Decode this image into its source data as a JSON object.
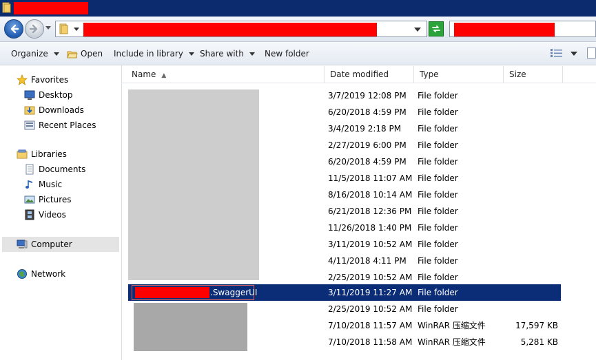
{
  "toolbar": {
    "organize": "Organize",
    "open": "Open",
    "include_in_library": "Include in library",
    "share_with": "Share with",
    "new_folder": "New folder"
  },
  "nav": {
    "favorites": "Favorites",
    "desktop": "Desktop",
    "downloads": "Downloads",
    "recent_places": "Recent Places",
    "libraries": "Libraries",
    "documents": "Documents",
    "music": "Music",
    "pictures": "Pictures",
    "videos": "Videos",
    "computer": "Computer",
    "network": "Network"
  },
  "columns": {
    "name": "Name",
    "date_modified": "Date modified",
    "type": "Type",
    "size": "Size"
  },
  "files": [
    {
      "name": "",
      "date": "3/7/2019 12:08 PM",
      "type": "File folder",
      "size": ""
    },
    {
      "name": "",
      "date": "6/20/2018 4:59 PM",
      "type": "File folder",
      "size": ""
    },
    {
      "name": "",
      "date": "3/4/2019 2:18 PM",
      "type": "File folder",
      "size": ""
    },
    {
      "name": "",
      "date": "2/27/2019 6:00 PM",
      "type": "File folder",
      "size": ""
    },
    {
      "name": "",
      "date": "6/20/2018 4:59 PM",
      "type": "File folder",
      "size": ""
    },
    {
      "name": "",
      "date": "11/5/2018 11:07 AM",
      "type": "File folder",
      "size": ""
    },
    {
      "name": "",
      "date": "8/16/2018 10:14 AM",
      "type": "File folder",
      "size": ""
    },
    {
      "name": "",
      "date": "6/21/2018 12:36 PM",
      "type": "File folder",
      "size": ""
    },
    {
      "name": "",
      "date": "11/26/2018 1:40 PM",
      "type": "File folder",
      "size": ""
    },
    {
      "name": "",
      "date": "3/11/2019 10:52 AM",
      "type": "File folder",
      "size": ""
    },
    {
      "name": "",
      "date": "4/11/2018 4:11 PM",
      "type": "File folder",
      "size": ""
    },
    {
      "name": "",
      "date": "2/25/2019 10:52 AM",
      "type": "File folder",
      "size": ""
    },
    {
      "name": ".SwaggerUI",
      "date": "3/11/2019 11:27 AM",
      "type": "File folder",
      "size": ""
    },
    {
      "name": "",
      "date": "2/25/2019 10:52 AM",
      "type": "File folder",
      "size": ""
    },
    {
      "name": "",
      "date": "7/10/2018 11:57 AM",
      "type": "WinRAR 压缩文件",
      "size": "17,597 KB"
    },
    {
      "name": "",
      "date": "7/10/2018 11:58 AM",
      "type": "WinRAR 压缩文件",
      "size": "5,281 KB"
    }
  ],
  "colors": {
    "title_bar": "#0c2a6e",
    "selection": "#0b2d78",
    "redaction": "#ff0000"
  }
}
